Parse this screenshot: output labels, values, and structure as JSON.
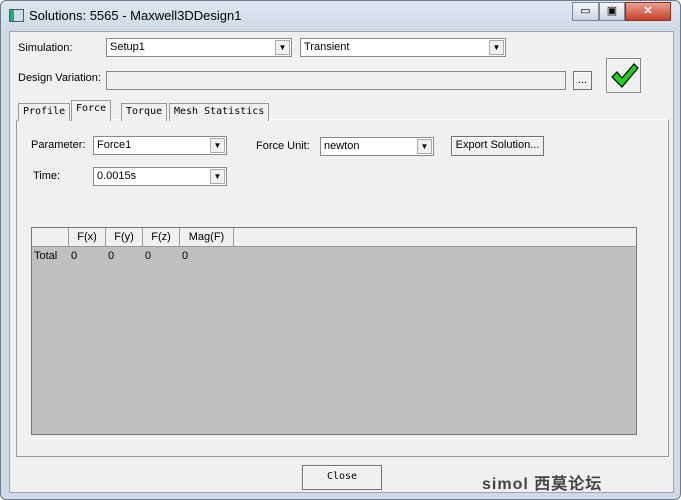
{
  "window": {
    "title": "Solutions: 5565 - Maxwell3DDesign1",
    "minimize": "▭",
    "maximize": "▣",
    "close": "✕"
  },
  "form": {
    "simulation_label": "Simulation:",
    "simulation_value": "Setup1",
    "solution_type": "Transient",
    "design_variation_label": "Design Variation:",
    "design_variation_value": "",
    "browse_label": "...",
    "status_icon": "check-icon"
  },
  "tabs": [
    {
      "label": "Profile"
    },
    {
      "label": "Force",
      "active": true
    },
    {
      "label": "Torque"
    },
    {
      "label": "Mesh Statistics"
    }
  ],
  "force": {
    "parameter_label": "Parameter:",
    "parameter_value": "Force1",
    "unit_label": "Force Unit:",
    "unit_value": "newton",
    "export_label": "Export Solution...",
    "time_label": "Time:",
    "time_value": "0.0015s"
  },
  "table": {
    "columns": [
      "",
      "F(x)",
      "F(y)",
      "F(z)",
      "Mag(F)"
    ],
    "rows": [
      {
        "name": "Total",
        "values": [
          "0",
          "0",
          "0",
          "0"
        ]
      }
    ]
  },
  "footer": {
    "close_label": "Close",
    "watermark": "simol 西莫论坛"
  },
  "colors": {
    "check": "#22cc22"
  }
}
